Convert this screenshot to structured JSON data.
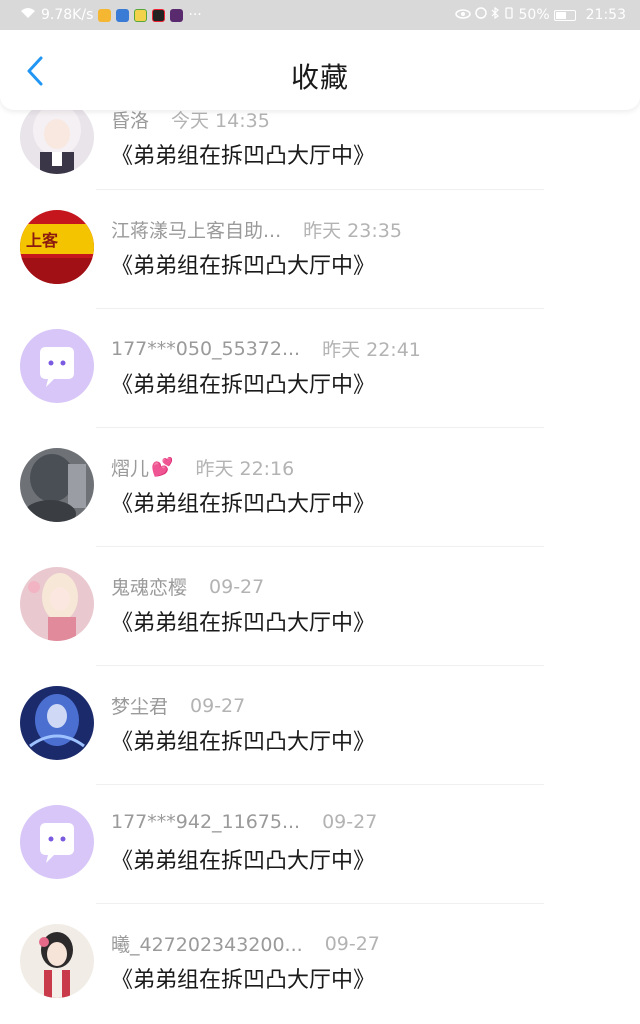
{
  "status_bar": {
    "net_speed": "9.78K/s",
    "more": "···",
    "battery_pct": "50%",
    "time": "21:53"
  },
  "header": {
    "title": "收藏",
    "back_icon": "chevron-left-icon"
  },
  "colors": {
    "accent": "#2196f3",
    "status_bar_bg": "#d9d9d9",
    "bot_avatar": "#d7c6f7"
  },
  "items": [
    {
      "name": "昏洛",
      "time": "今天 14:35",
      "message": "《弟弟组在拆凹凸大厅中》",
      "avatar": "anime-girl-white-hair"
    },
    {
      "name": "江蒋漾马上客自助...",
      "time": "昨天 23:35",
      "message": "《弟弟组在拆凹凸大厅中》",
      "avatar": "shop-sign-red"
    },
    {
      "name": "177***050_55372...",
      "time": "昨天 22:41",
      "message": "《弟弟组在拆凹凸大厅中》",
      "avatar": "chat-bubble-default"
    },
    {
      "name": "熠儿",
      "emoji": "💕",
      "time": "昨天 22:16",
      "message": "《弟弟组在拆凹凸大厅中》",
      "avatar": "dark-photo"
    },
    {
      "name": "鬼魂恋樱",
      "time": "09-27",
      "message": "《弟弟组在拆凹凸大厅中》",
      "avatar": "anime-girl-pink"
    },
    {
      "name": "梦尘君",
      "time": "09-27",
      "message": "《弟弟组在拆凹凸大厅中》",
      "avatar": "blue-fantasy"
    },
    {
      "name": "177***942_11675...",
      "time": "09-27",
      "message": "《弟弟组在拆凹凸大厅中》",
      "avatar": "chat-bubble-default"
    },
    {
      "name": "曦_427202343200...",
      "time": "09-27",
      "message": "《弟弟组在拆凹凸大厅中》",
      "avatar": "ancient-style-girl"
    }
  ]
}
